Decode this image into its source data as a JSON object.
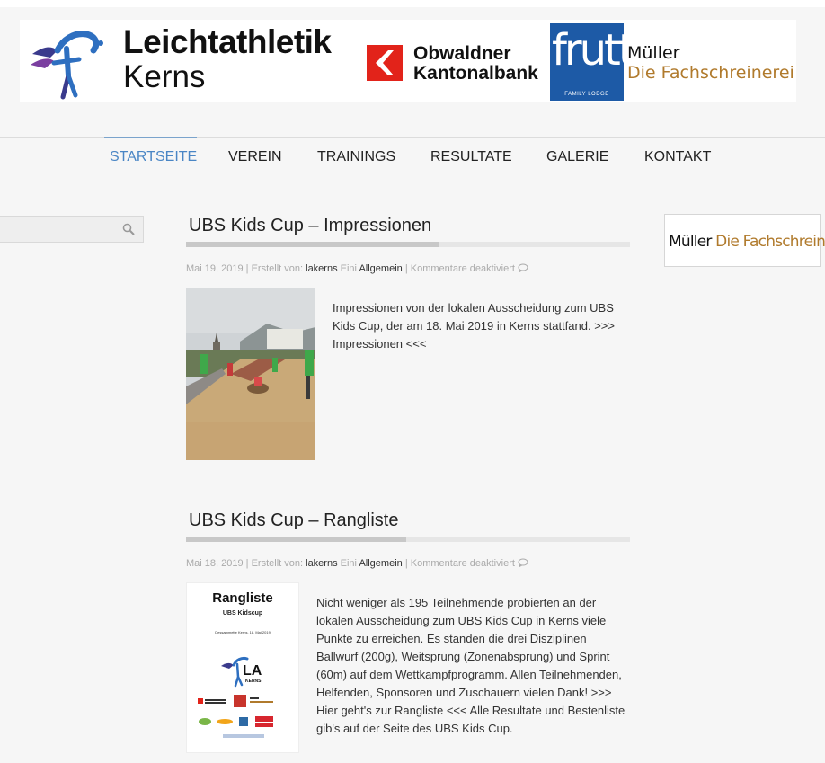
{
  "banner": {
    "la_title_1": "Leichtathletik",
    "la_title_2": "Kerns",
    "okb_line_1": "Obwaldner",
    "okb_line_2": "Kantonalbank",
    "frutt_word": "frutt",
    "frutt_sub": "FAMILY LODGE",
    "muller_line_1": "Müller",
    "muller_line_2": "Die Fachschreinerei"
  },
  "nav": {
    "items": [
      {
        "label": "STARTSEITE",
        "active": true
      },
      {
        "label": "VEREIN",
        "active": false
      },
      {
        "label": "TRAININGS",
        "active": false
      },
      {
        "label": "RESULTATE",
        "active": false
      },
      {
        "label": "GALERIE",
        "active": false
      },
      {
        "label": "KONTAKT",
        "active": false
      }
    ]
  },
  "search": {
    "placeholder": "",
    "icon": "search-icon"
  },
  "right_widget": {
    "name": "Müller",
    "tagline": "Die Fachschreinerei"
  },
  "posts": [
    {
      "title": "UBS Kids Cup – Impressionen",
      "date": "Mai 19, 2019",
      "created_by": "Erstellt von:",
      "author": "lakerns",
      "in_label": "Eini",
      "category": "Allgemein",
      "comments": "Kommentare deaktiviert",
      "excerpt": "Impressionen von der lokalen Ausscheidung zum UBS Kids Cup, der am 18. Mai 2019 in Kerns stattfand. >>> Impressionen <<<"
    },
    {
      "title": "UBS Kids Cup – Rangliste",
      "date": "Mai 18, 2019",
      "created_by": "Erstellt von:",
      "author": "lakerns",
      "in_label": "Eini",
      "category": "Allgemein",
      "comments": "Kommentare deaktiviert",
      "excerpt": "Nicht weniger als 195 Teilnehmende probierten an der lokalen Ausscheidung zum UBS Kids Cup in Kerns viele Punkte zu erreichen. Es standen die drei Disziplinen Ballwurf (200g), Weitsprung (Zonenabsprung) und Sprint (60m) auf dem Wettkampfprogramm. Allen Teilnehmenden, Helfenden, Sponsoren und Zuschauern vielen Dank!   >>> Hier geht's zur Rangliste <<< Alle Resultate und Bestenliste gib's auf der Seite des UBS Kids Cup.",
      "thumb": {
        "title": "Rangliste",
        "subtitle": "UBS Kidscup",
        "date_line": "Dessammette Kerns, 18. Mai 2019"
      }
    }
  ],
  "colors": {
    "nav_active": "#4a86c5",
    "frutt_blue": "#1d5aa6",
    "muller_gold": "#b07a2c",
    "okb_red": "#e2231a"
  }
}
